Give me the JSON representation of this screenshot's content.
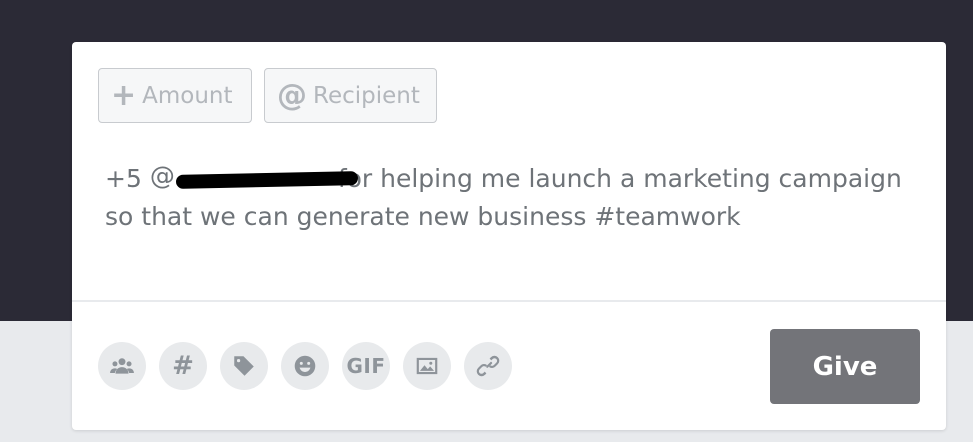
{
  "composer": {
    "amount_chip": {
      "icon": "plus-icon",
      "icon_glyph": "+",
      "label": "Amount"
    },
    "recipient_chip": {
      "icon": "at-icon",
      "icon_glyph": "@",
      "label": "Recipient"
    },
    "message": {
      "prefix": "+5",
      "mention_at": "@",
      "mention_redacted": true,
      "text": "for helping me launch a marketing campaign so that we can generate new business #teamwork"
    },
    "toolbar": [
      {
        "name": "group-icon"
      },
      {
        "name": "hashtag-icon",
        "glyph": "#"
      },
      {
        "name": "tag-icon"
      },
      {
        "name": "emoji-icon"
      },
      {
        "name": "gif-icon",
        "glyph": "GIF"
      },
      {
        "name": "image-icon"
      },
      {
        "name": "link-icon"
      }
    ],
    "give_label": "Give"
  },
  "colors": {
    "header_bg": "#2b2a36",
    "page_bg": "#e8eaed",
    "give_button_bg": "#737479",
    "muted_text": "#6e7378"
  }
}
